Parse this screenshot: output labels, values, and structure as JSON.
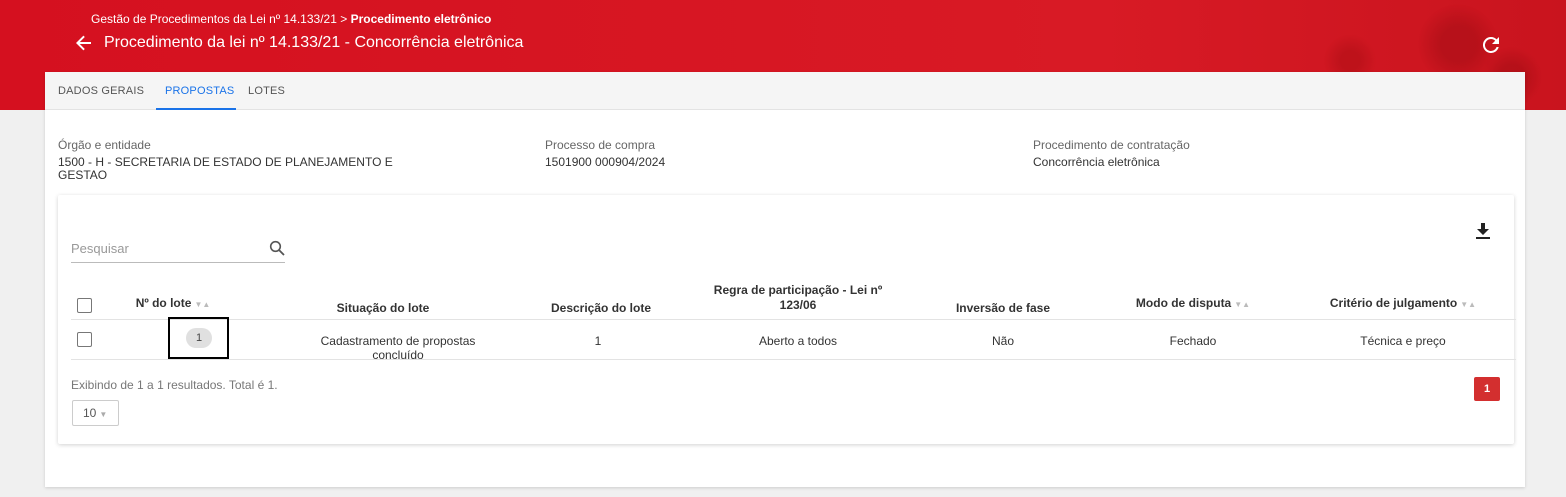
{
  "header": {
    "breadcrumb_parent": "Gestão de Procedimentos da Lei nº 14.133/21",
    "breadcrumb_sep": ">",
    "breadcrumb_current": "Procedimento eletrônico",
    "title": "Procedimento da lei nº 14.133/21 - Concorrência eletrônica",
    "back_icon": "arrow-left-icon",
    "refresh_icon": "refresh-icon"
  },
  "tabs": [
    {
      "label": "DADOS GERAIS",
      "active": false
    },
    {
      "label": "PROPOSTAS",
      "active": true
    },
    {
      "label": "LOTES",
      "active": false
    }
  ],
  "info": {
    "orgao": {
      "label": "Órgão e entidade",
      "value": "1500 - H - SECRETARIA DE ESTADO DE PLANEJAMENTO E GESTAO"
    },
    "processo": {
      "label": "Processo de compra",
      "value": "1501900 000904/2024"
    },
    "procedimento": {
      "label": "Procedimento de contratação",
      "value": "Concorrência eletrônica"
    }
  },
  "search": {
    "placeholder": "Pesquisar"
  },
  "table": {
    "columns": [
      {
        "label": "Nº do lote",
        "sortable": true
      },
      {
        "label": "Situação do lote",
        "sortable": false
      },
      {
        "label": "Descrição do lote",
        "sortable": false
      },
      {
        "label": "Regra de participação - Lei nº 123/06",
        "sortable": false
      },
      {
        "label": "Inversão de fase",
        "sortable": false
      },
      {
        "label": "Modo de disputa",
        "sortable": true
      },
      {
        "label": "Critério de julgamento",
        "sortable": true
      }
    ],
    "rows": [
      [
        "1",
        "Cadastramento de propostas concluído",
        "1",
        "Aberto a todos",
        "Não",
        "Fechado",
        "Técnica e preço"
      ]
    ]
  },
  "footer": {
    "summary": "Exibindo de 1 a 1 resultados. Total é 1.",
    "page_size": "10",
    "current_page": "1"
  },
  "colors": {
    "header_red": "#d5101f",
    "accent_blue": "#1a73e8",
    "page_button": "#d32f2f"
  }
}
